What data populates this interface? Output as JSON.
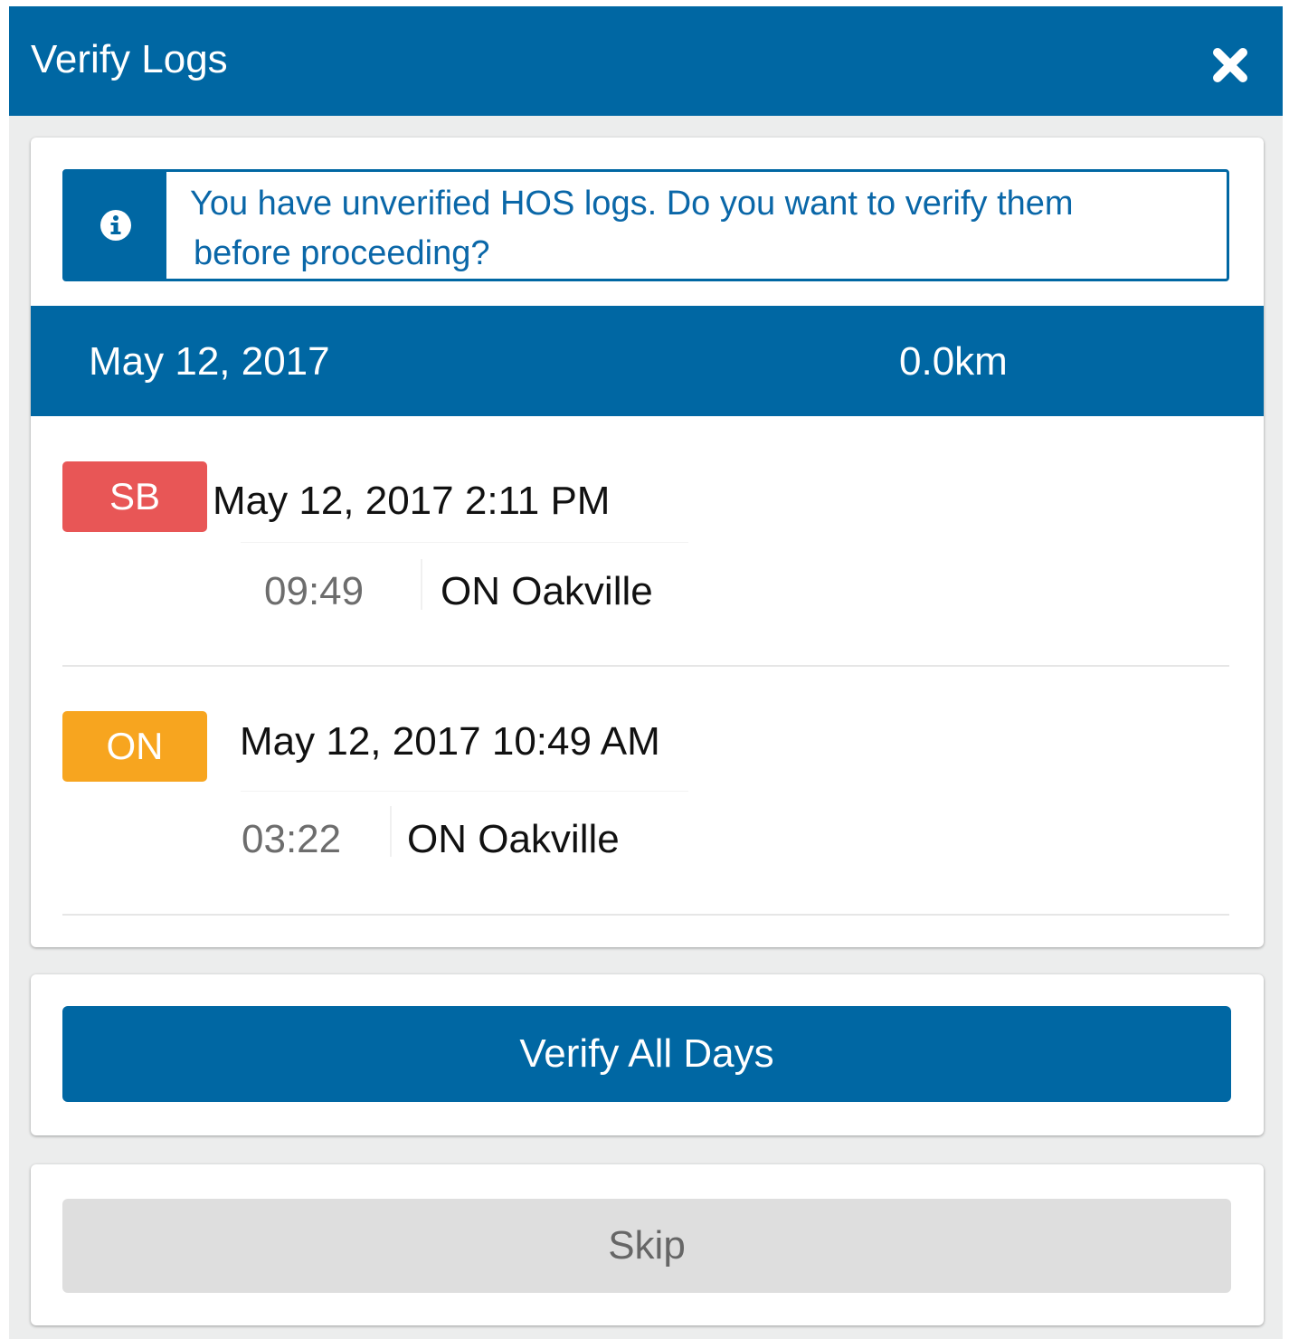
{
  "header": {
    "title": "Verify Logs",
    "close_icon": "close-icon"
  },
  "alert": {
    "icon": "info-icon",
    "line1": "You have unverified HOS logs. Do you want to verify them",
    "line2": "before proceeding?"
  },
  "day": {
    "date": "May 12, 2017",
    "distance": "0.0km"
  },
  "entries": [
    {
      "status": "SB",
      "status_color": "#e85656",
      "time": "May 12, 2017 2:11 PM",
      "duration": "09:49",
      "location": "ON Oakville"
    },
    {
      "status": "ON",
      "status_color": "#f7a51f",
      "time": "May 12, 2017 10:49 AM",
      "duration": "03:22",
      "location": "ON Oakville"
    }
  ],
  "actions": {
    "verify_all_label": "Verify All Days",
    "skip_label": "Skip"
  },
  "colors": {
    "primary": "#0067a3",
    "background": "#eceded",
    "skip_button": "#dedede"
  }
}
